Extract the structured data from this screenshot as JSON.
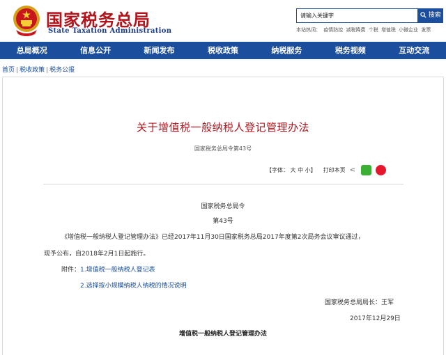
{
  "header": {
    "logo_cn": "国家税务总局",
    "logo_en": "State Taxation Administration",
    "search_placeholder": "请输入关键字",
    "search_button": "搜索",
    "hotwords_label": "本站热词：",
    "hotwords": [
      "疫情防控",
      "减税降费",
      "个税",
      "增值税",
      "小微企业",
      "发票"
    ]
  },
  "nav": {
    "items": [
      "总局概况",
      "信息公开",
      "新闻发布",
      "税收政策",
      "纳税服务",
      "税务视频",
      "互动交流"
    ]
  },
  "breadcrumb": {
    "items": [
      "首页",
      "税收政策",
      "税务公报"
    ],
    "separator": "|"
  },
  "article": {
    "title": "关于增值税一般纳税人登记管理办法",
    "doc_number": "国家税务总局令第43号",
    "font_size_label": "【字体：",
    "font_sizes": [
      "大",
      "中",
      "小"
    ],
    "font_size_close": "】",
    "print_label": "打印本页",
    "share_symbol": "<",
    "header_line": "国家税务总局令",
    "number_line": "第43号",
    "body_line1": "《增值税一般纳税人登记管理办法》已经2017年11月30日国家税务总局2017年度第2次局务会议审议通过，",
    "body_line2": "现予公布，自2018年2月1日起施行。",
    "attachment_label": "附件：",
    "attachments": [
      "1.增值税一般纳税人登记表",
      "2.选择按小规模纳税人纳税的情况说明"
    ],
    "signature": "国家税务总局局长：王军",
    "date": "2017年12月29日",
    "section_title": "增值税一般纳税人登记管理办法"
  },
  "colors": {
    "brand_blue": "#1c4e9e",
    "brand_red": "#b3131b"
  }
}
